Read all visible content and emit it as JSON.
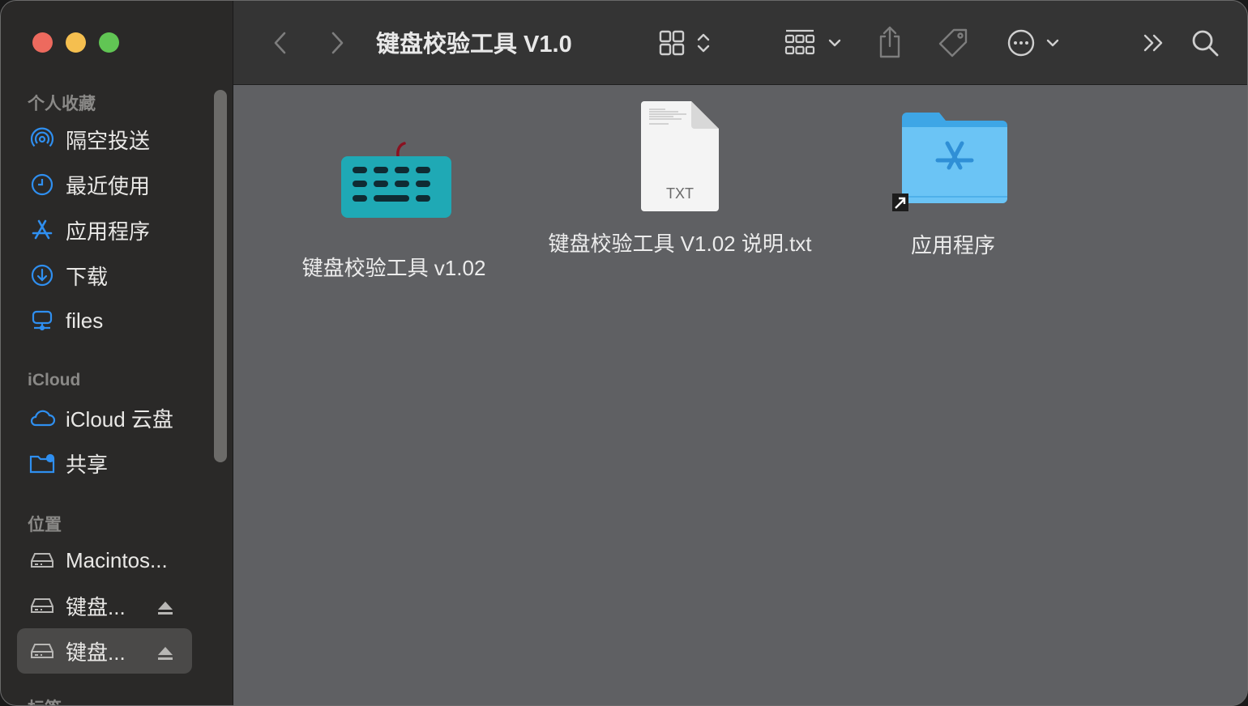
{
  "window": {
    "title": "键盘校验工具 V1.0"
  },
  "sidebar": {
    "sections": [
      {
        "label": "个人收藏"
      },
      {
        "label": "iCloud"
      },
      {
        "label": "位置"
      },
      {
        "label": "标签"
      }
    ],
    "favorites": [
      {
        "label": "隔空投送",
        "icon": "airdrop-icon"
      },
      {
        "label": "最近使用",
        "icon": "clock-icon"
      },
      {
        "label": "应用程序",
        "icon": "app-store-icon"
      },
      {
        "label": "下载",
        "icon": "download-icon"
      },
      {
        "label": "files",
        "icon": "network-drive-icon"
      }
    ],
    "icloud": [
      {
        "label": "iCloud 云盘",
        "icon": "cloud-icon"
      },
      {
        "label": "共享",
        "icon": "shared-folder-icon"
      }
    ],
    "locations": [
      {
        "label": "Macintos...",
        "icon": "drive-icon"
      },
      {
        "label": "键盘...",
        "icon": "drive-icon",
        "eject": true
      },
      {
        "label": "键盘...",
        "icon": "drive-icon",
        "eject": true,
        "selected": true
      }
    ]
  },
  "files": [
    {
      "name": "键盘校验工具 v1.02",
      "icon": "keyboard-app-icon"
    },
    {
      "name": "键盘校验工具 V1.02 说明.txt",
      "icon": "txt-document-icon",
      "badge": "TXT"
    },
    {
      "name": "应用程序",
      "icon": "applications-folder-alias-icon"
    }
  ],
  "colors": {
    "accent": "#2f8ff0",
    "keyboard": "#1fa9b5",
    "folder": "#6bc4f5"
  }
}
